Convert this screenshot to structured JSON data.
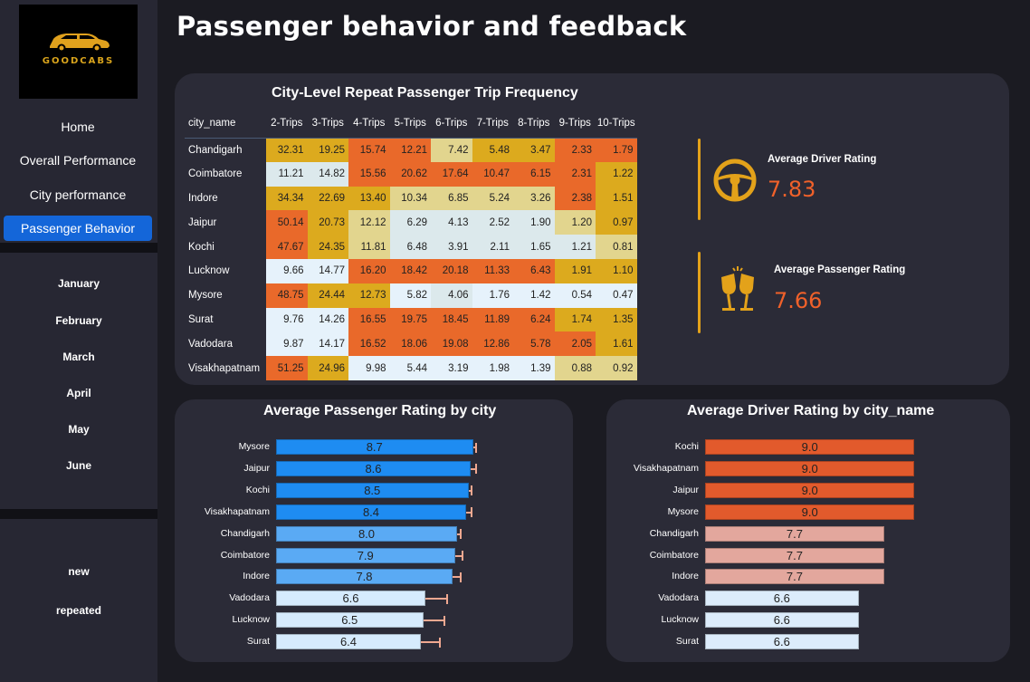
{
  "app": {
    "logo_text": "GOODCABS",
    "title": "Passenger behavior and feedback"
  },
  "sidebar": {
    "nav": [
      {
        "label": "Home",
        "active": false
      },
      {
        "label": "Overall Performance",
        "active": false
      },
      {
        "label": "City performance",
        "active": false
      },
      {
        "label": "Passenger Behavior",
        "active": true
      }
    ],
    "months": [
      "January",
      "February",
      "March",
      "April",
      "May",
      "June"
    ],
    "passenger_types": [
      "new",
      "repeated"
    ]
  },
  "heatmap": {
    "title": "City-Level Repeat Passenger Trip Frequency",
    "row_header": "city_name",
    "columns": [
      "2-Trips",
      "3-Trips",
      "4-Trips",
      "5-Trips",
      "6-Trips",
      "7-Trips",
      "8-Trips",
      "9-Trips",
      "10-Trips"
    ],
    "rows": [
      {
        "city": "Chandigarh",
        "values": [
          "32.31",
          "19.25",
          "15.74",
          "12.21",
          "7.42",
          "5.48",
          "3.47",
          "2.33",
          "1.79"
        ],
        "colors": [
          "#dcaa1e",
          "#dcaa1e",
          "#e9692a",
          "#e9692a",
          "#e2d58e",
          "#dcaa1e",
          "#dcaa1e",
          "#e9692a",
          "#e9692a"
        ]
      },
      {
        "city": "Coimbatore",
        "values": [
          "11.21",
          "14.82",
          "15.56",
          "20.62",
          "17.64",
          "10.47",
          "6.15",
          "2.31",
          "1.22"
        ],
        "colors": [
          "#dce9ec",
          "#dce9ec",
          "#e9692a",
          "#e9692a",
          "#e9692a",
          "#e9692a",
          "#e9692a",
          "#e9692a",
          "#dcaa1e"
        ]
      },
      {
        "city": "Indore",
        "values": [
          "34.34",
          "22.69",
          "13.40",
          "10.34",
          "6.85",
          "5.24",
          "3.26",
          "2.38",
          "1.51"
        ],
        "colors": [
          "#dcaa1e",
          "#dcaa1e",
          "#dcaa1e",
          "#e2d58e",
          "#e2d58e",
          "#e2d58e",
          "#e2d58e",
          "#e9692a",
          "#dcaa1e"
        ]
      },
      {
        "city": "Jaipur",
        "values": [
          "50.14",
          "20.73",
          "12.12",
          "6.29",
          "4.13",
          "2.52",
          "1.90",
          "1.20",
          "0.97"
        ],
        "colors": [
          "#e9692a",
          "#dcaa1e",
          "#e2d58e",
          "#dce9ec",
          "#dce9ec",
          "#dce9ec",
          "#dce9ec",
          "#e2d58e",
          "#dcaa1e"
        ]
      },
      {
        "city": "Kochi",
        "values": [
          "47.67",
          "24.35",
          "11.81",
          "6.48",
          "3.91",
          "2.11",
          "1.65",
          "1.21",
          "0.81"
        ],
        "colors": [
          "#e9692a",
          "#dcaa1e",
          "#e2d58e",
          "#dce9ec",
          "#dce9ec",
          "#dce9ec",
          "#dce9ec",
          "#dce9ec",
          "#e2d58e"
        ]
      },
      {
        "city": "Lucknow",
        "values": [
          "9.66",
          "14.77",
          "16.20",
          "18.42",
          "20.18",
          "11.33",
          "6.43",
          "1.91",
          "1.10"
        ],
        "colors": [
          "#e6f2fb",
          "#e6f2fb",
          "#e9692a",
          "#e9692a",
          "#e9692a",
          "#e9692a",
          "#e9692a",
          "#dcaa1e",
          "#dcaa1e"
        ]
      },
      {
        "city": "Mysore",
        "values": [
          "48.75",
          "24.44",
          "12.73",
          "5.82",
          "4.06",
          "1.76",
          "1.42",
          "0.54",
          "0.47"
        ],
        "colors": [
          "#e9692a",
          "#dcaa1e",
          "#dcaa1e",
          "#e6f2fb",
          "#dce9ec",
          "#e6f2fb",
          "#e6f2fb",
          "#e6f2fb",
          "#e6f2fb"
        ]
      },
      {
        "city": "Surat",
        "values": [
          "9.76",
          "14.26",
          "16.55",
          "19.75",
          "18.45",
          "11.89",
          "6.24",
          "1.74",
          "1.35"
        ],
        "colors": [
          "#e6f2fb",
          "#e6f2fb",
          "#e9692a",
          "#e9692a",
          "#e9692a",
          "#e9692a",
          "#e9692a",
          "#dcaa1e",
          "#dcaa1e"
        ]
      },
      {
        "city": "Vadodara",
        "values": [
          "9.87",
          "14.17",
          "16.52",
          "18.06",
          "19.08",
          "12.86",
          "5.78",
          "2.05",
          "1.61"
        ],
        "colors": [
          "#e6f2fb",
          "#e6f2fb",
          "#e9692a",
          "#e9692a",
          "#e9692a",
          "#e9692a",
          "#e9692a",
          "#e9692a",
          "#dcaa1e"
        ]
      },
      {
        "city": "Visakhapatnam",
        "values": [
          "51.25",
          "24.96",
          "9.98",
          "5.44",
          "3.19",
          "1.98",
          "1.39",
          "0.88",
          "0.92"
        ],
        "colors": [
          "#e9692a",
          "#dcaa1e",
          "#e6f2fb",
          "#e6f2fb",
          "#e6f2fb",
          "#e6f2fb",
          "#e6f2fb",
          "#e2d58e",
          "#e2d58e"
        ]
      }
    ]
  },
  "kpis": {
    "driver": {
      "label": "Average Driver Rating",
      "value": "7.83",
      "icon": "steering-wheel-icon"
    },
    "passenger": {
      "label": "Average Passenger Rating",
      "value": "7.66",
      "icon": "cheers-icon"
    }
  },
  "passenger_chart": {
    "title": "Average Passenger Rating by city",
    "type": "bar",
    "axis_max": 10,
    "categories": [
      "Mysore",
      "Jaipur",
      "Kochi",
      "Visakhapatnam",
      "Chandigarh",
      "Coimbatore",
      "Indore",
      "Vadodara",
      "Lucknow",
      "Surat"
    ],
    "values": [
      8.7,
      8.6,
      8.5,
      8.4,
      8.0,
      7.9,
      7.8,
      6.6,
      6.5,
      6.4
    ],
    "labels": [
      "8.7",
      "8.6",
      "8.5",
      "8.4",
      "8.0",
      "7.9",
      "7.8",
      "6.6",
      "6.5",
      "6.4"
    ],
    "error_high": [
      8.8,
      8.8,
      8.6,
      8.6,
      8.1,
      8.2,
      8.1,
      7.5,
      7.4,
      7.2
    ],
    "colors": [
      "#1e8cf2",
      "#1e8cf2",
      "#1e8cf2",
      "#1e8cf2",
      "#5aaaf4",
      "#5aaaf4",
      "#5aaaf4",
      "#d6ebfd",
      "#d6ebfd",
      "#d6ebfd"
    ]
  },
  "driver_chart": {
    "title": "Average Driver Rating by city_name",
    "type": "bar",
    "axis_max": 10,
    "categories": [
      "Kochi",
      "Visakhapatnam",
      "Jaipur",
      "Mysore",
      "Chandigarh",
      "Coimbatore",
      "Indore",
      "Vadodara",
      "Lucknow",
      "Surat"
    ],
    "values": [
      9.0,
      9.0,
      9.0,
      9.0,
      7.7,
      7.7,
      7.7,
      6.6,
      6.6,
      6.6
    ],
    "labels": [
      "9.0",
      "9.0",
      "9.0",
      "9.0",
      "7.7",
      "7.7",
      "7.7",
      "6.6",
      "6.6",
      "6.6"
    ],
    "colors": [
      "#e25a2c",
      "#e25a2c",
      "#e25a2c",
      "#e25a2c",
      "#e3a79d",
      "#e3a79d",
      "#e3a79d",
      "#dcecfb",
      "#dcecfb",
      "#dcecfb"
    ]
  }
}
